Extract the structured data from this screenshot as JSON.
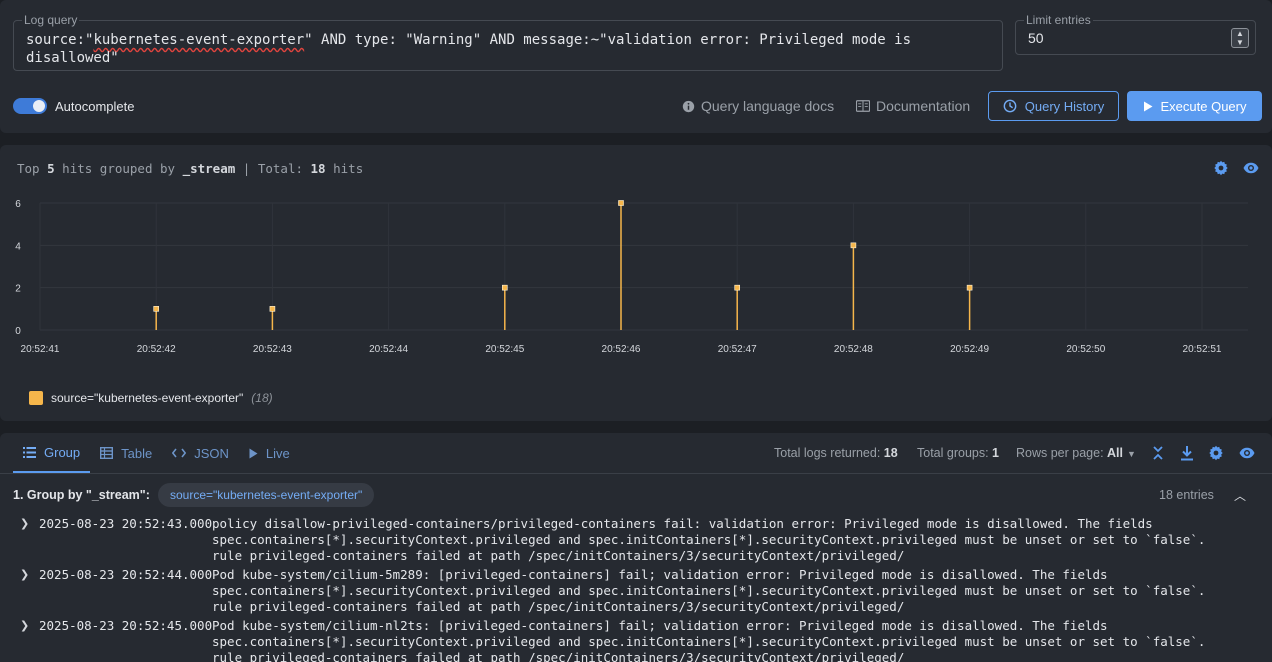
{
  "query": {
    "legend": "Log query",
    "text_before": "source:\"",
    "text_flagged": "kubernetes-event-exporter",
    "text_after": "\" AND type: \"Warning\" AND message:~\"validation error: Privileged mode is disallowed\""
  },
  "limit": {
    "legend": "Limit entries",
    "value": "50"
  },
  "autocomplete": {
    "label": "Autocomplete",
    "enabled": true
  },
  "links": {
    "query_docs": "Query language docs",
    "documentation": "Documentation"
  },
  "buttons": {
    "history": "Query History",
    "execute": "Execute Query"
  },
  "chart_summary": {
    "prefix": "Top ",
    "top_n": "5",
    "mid": " hits grouped by ",
    "field": "_stream",
    "sep": " | Total: ",
    "total": "18",
    "suffix": " hits"
  },
  "chart_data": {
    "type": "bar",
    "categories": [
      "20:52:41",
      "20:52:42",
      "20:52:43",
      "20:52:44",
      "20:52:45",
      "20:52:46",
      "20:52:47",
      "20:52:48",
      "20:52:49",
      "20:52:50",
      "20:52:51"
    ],
    "series": [
      {
        "name": "source=\"kubernetes-event-exporter\"",
        "values": [
          0,
          1,
          1,
          0,
          2,
          6,
          2,
          4,
          2,
          0,
          0
        ],
        "color": "#f6b64b"
      }
    ],
    "yticks": [
      "0",
      "2",
      "4",
      "6"
    ],
    "ylim": [
      0,
      6
    ],
    "grid": true,
    "legend_position": "bottom-left",
    "legend_count": "(18)"
  },
  "tabs": [
    {
      "label": "Group",
      "icon": "list-icon",
      "active": true
    },
    {
      "label": "Table",
      "icon": "table-icon",
      "active": false
    },
    {
      "label": "JSON",
      "icon": "code-icon",
      "active": false
    },
    {
      "label": "Live",
      "icon": "play-icon",
      "active": false
    }
  ],
  "stats": {
    "total_logs_label": "Total logs returned: ",
    "total_logs": "18",
    "total_groups_label": "Total groups: ",
    "total_groups": "1",
    "rows_per_page_label": "Rows per page: ",
    "rows_per_page": "All"
  },
  "group": {
    "label": "1. Group by \"_stream\":",
    "chip": "source=\"kubernetes-event-exporter\"",
    "count": "18 entries"
  },
  "rows": [
    {
      "timestamp": "2025-08-23 20:52:43.000",
      "message": "policy disallow-privileged-containers/privileged-containers fail: validation error: Privileged mode is disallowed. The fields\nspec.containers[*].securityContext.privileged and spec.initContainers[*].securityContext.privileged must be unset or set to `false`.\nrule privileged-containers failed at path /spec/initContainers/3/securityContext/privileged/"
    },
    {
      "timestamp": "2025-08-23 20:52:44.000",
      "message": "Pod kube-system/cilium-5m289: [privileged-containers] fail; validation error: Privileged mode is disallowed. The fields\nspec.containers[*].securityContext.privileged and spec.initContainers[*].securityContext.privileged must be unset or set to `false`.\nrule privileged-containers failed at path /spec/initContainers/3/securityContext/privileged/"
    },
    {
      "timestamp": "2025-08-23 20:52:45.000",
      "message": "Pod kube-system/cilium-nl2ts: [privileged-containers] fail; validation error: Privileged mode is disallowed. The fields\nspec.containers[*].securityContext.privileged and spec.initContainers[*].securityContext.privileged must be unset or set to `false`.\nrule privileged-containers failed at path /spec/initContainers/3/securityContext/privileged/"
    }
  ]
}
